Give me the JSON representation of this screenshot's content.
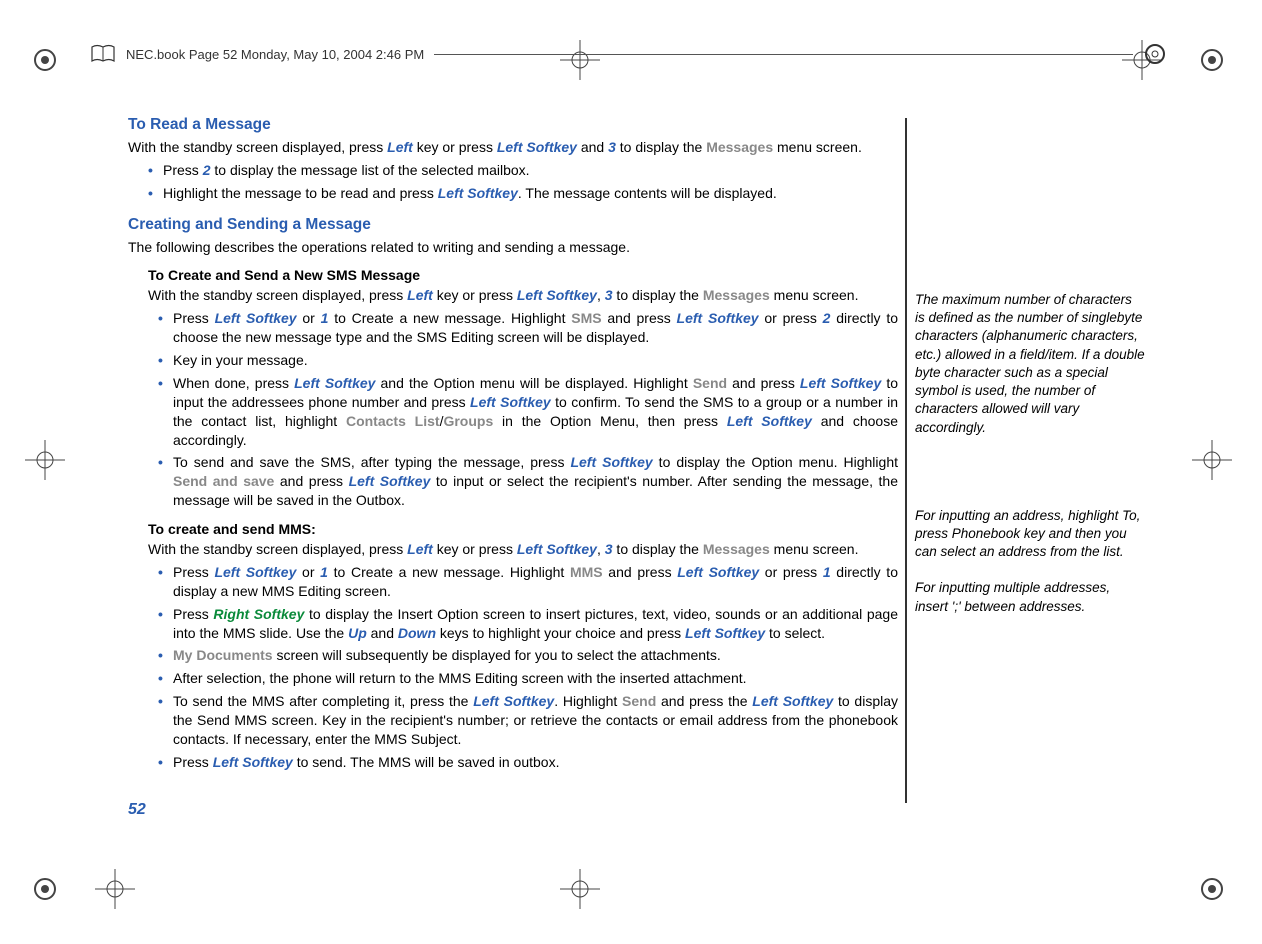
{
  "header": {
    "text": "NEC.book  Page 52  Monday, May 10, 2004  2:46 PM"
  },
  "page_number": "52",
  "s1": {
    "title": "To Read a Message",
    "intro_a": "With the standby screen displayed, press ",
    "intro_b": " key or press ",
    "intro_c": " and ",
    "intro_d": " to display the ",
    "intro_e": " menu screen.",
    "k_left": "Left",
    "k_ls": "Left Softkey",
    "k_3": "3",
    "k_messages": "Messages",
    "b1a": "Press ",
    "b1b": " to display the message list of the selected mailbox.",
    "k_2": "2",
    "b2a": "Highlight the message to be read and press ",
    "b2b": ". The message contents will be displayed."
  },
  "s2": {
    "title": "Creating and Sending a Message",
    "intro": "The following describes the operations related to writing and sending a message."
  },
  "s3": {
    "title": "To Create and Send a New SMS Message",
    "line_a": "With the standby screen displayed, press ",
    "line_b": " key or press ",
    "line_c": ", ",
    "line_d": " to display the ",
    "line_e": " menu screen.",
    "k_left": "Left",
    "k_ls": "Left Softkey",
    "k_3": "3",
    "k_messages": "Messages",
    "b1a": "Press ",
    "b1b": " or ",
    "b1c": "  to Create a new message. Highlight ",
    "b1d": " and press ",
    "b1e": " or press ",
    "b1f": " directly to choose the new message type and the SMS Editing screen will be displayed.",
    "k_1": "1",
    "k_sms": "SMS",
    "k_2": "2",
    "b2": "Key in your message.",
    "b3a": "When done, press ",
    "b3b": " and the Option menu will be displayed. Highlight ",
    "b3c": " and press ",
    "b3d": " to input the addressees phone number and press ",
    "b3e": " to confirm. To send the SMS to a group or a number in the contact list, highlight ",
    "b3f": "/",
    "b3g": " in the Option Menu, then press ",
    "b3h": " and choose accordingly.",
    "k_send": "Send",
    "k_cl": "Contacts List",
    "k_groups": "Groups",
    "b4a": "To send and save the SMS, after typing the message, press ",
    "b4b": " to display the Option menu. Highlight ",
    "b4c": "  and press ",
    "b4d": " to input or select the recipient's number. After sending the message, the message will be saved in the Outbox.",
    "k_sendsave": "Send and save"
  },
  "s4": {
    "title": "To create and send MMS:",
    "line_a": "With the standby screen displayed, press ",
    "line_b": " key or press ",
    "line_c": ", ",
    "line_d": " to display the ",
    "line_e": " menu screen.",
    "k_left": "Left",
    "k_ls": "Left Softkey",
    "k_3": "3",
    "k_messages": "Messages",
    "b1a": "Press ",
    "b1b": " or ",
    "b1c": "  to Create a new message. Highlight ",
    "b1d": " and press ",
    "b1e": " or press ",
    "b1f": " directly to display a new MMS Editing screen.",
    "k_1": "1",
    "k_mms": "MMS",
    "b2a": "Press ",
    "b2b": " to display the Insert Option screen to insert pictures, text, video, sounds or an additional page into the MMS slide. Use the ",
    "b2c": " and ",
    "b2d": " keys to highlight your choice and press ",
    "b2e": " to select.",
    "k_rs": "Right Softkey",
    "k_up": "Up",
    "k_down": "Down",
    "b3a": "",
    "b3b": " screen will subsequently be displayed for you to select the attachments.",
    "k_mydocs": "My Documents",
    "b4": "After selection, the phone will return to the MMS Editing screen with the inserted attachment.",
    "b5a": "To send the MMS after completing it, press the ",
    "b5b": ". Highlight ",
    "b5c": " and press the ",
    "b5d": " to display the Send MMS screen. Key in the recipient's number; or retrieve the contacts or email address from the phonebook contacts. If necessary, enter the MMS Subject.",
    "k_send": "Send",
    "b6a": "Press ",
    "b6b": " to send. The MMS will be saved in outbox."
  },
  "side": {
    "n1": "The maximum number of characters is defined as the number of singlebyte characters (alphanumeric characters, etc.) allowed in a field/item. If a double byte character such as a special symbol is used, the number of characters allowed will vary accordingly.",
    "n2": "For inputting an address, highlight To, press Phonebook key and then you can select an address from the list.",
    "n3": "For inputting multiple addresses, insert ';' between addresses."
  }
}
